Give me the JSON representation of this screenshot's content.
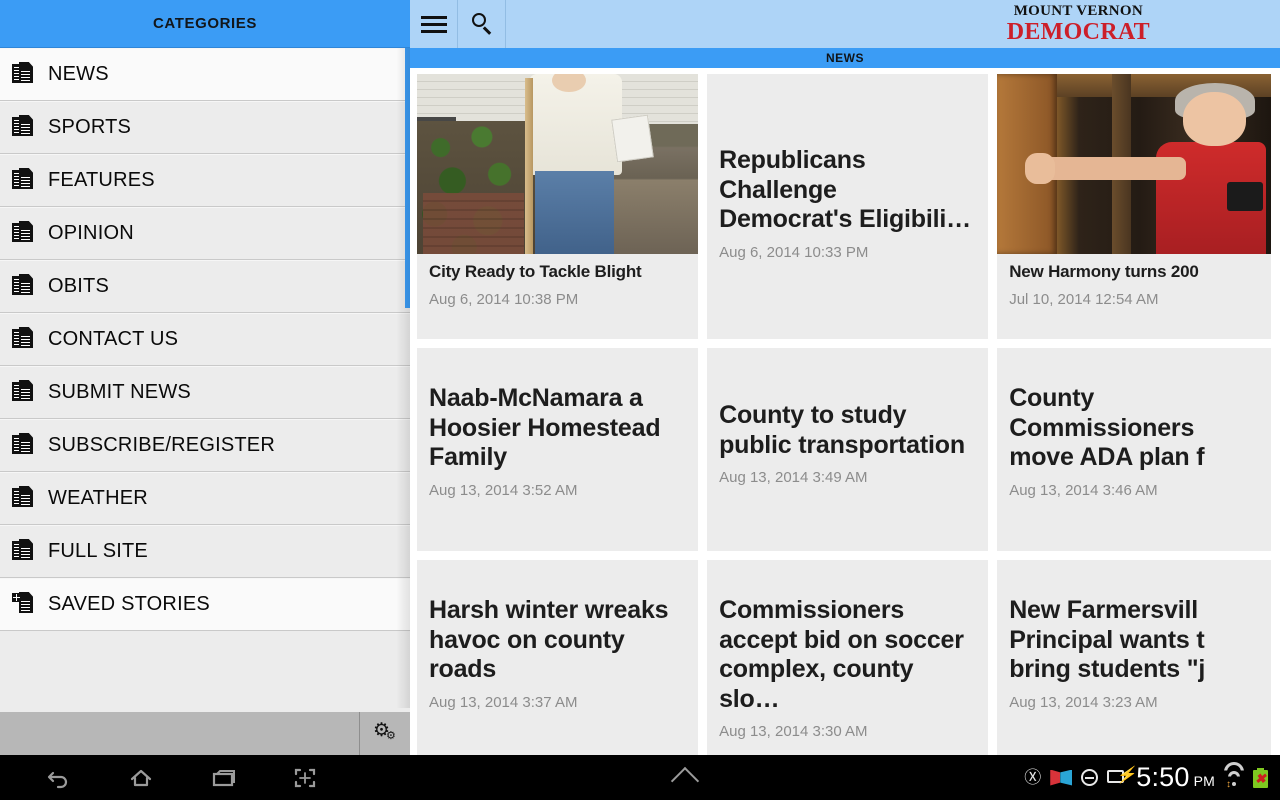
{
  "drawer": {
    "header_title": "CATEGORIES",
    "items": [
      {
        "label": "NEWS",
        "icon": "documents-icon",
        "selected": true
      },
      {
        "label": "SPORTS",
        "icon": "documents-icon",
        "selected": false
      },
      {
        "label": "FEATURES",
        "icon": "documents-icon",
        "selected": false
      },
      {
        "label": "OPINION",
        "icon": "documents-icon",
        "selected": false
      },
      {
        "label": "OBITS",
        "icon": "documents-icon",
        "selected": false
      },
      {
        "label": "CONTACT US",
        "icon": "documents-icon",
        "selected": false
      },
      {
        "label": "SUBMIT NEWS",
        "icon": "documents-icon",
        "selected": false
      },
      {
        "label": "SUBSCRIBE/REGISTER",
        "icon": "documents-icon",
        "selected": false
      },
      {
        "label": "WEATHER",
        "icon": "documents-icon",
        "selected": false
      },
      {
        "label": "FULL SITE",
        "icon": "documents-icon",
        "selected": false
      },
      {
        "label": "SAVED STORIES",
        "icon": "add-document-icon",
        "selected": false
      }
    ],
    "footer": {
      "settings_icon": "gear-icon"
    }
  },
  "app_bar": {
    "menu_icon": "hamburger-menu-icon",
    "search_icon": "search-icon",
    "masthead_line1": "MOUNT VERNON",
    "masthead_line2": "DEMOCRAT",
    "masthead_color": "#cc1f2a",
    "accent_color": "#3b9cf5",
    "bar_color": "#aed4f7"
  },
  "section_bar": {
    "label": "NEWS"
  },
  "articles": [
    {
      "title": "City Ready to Tackle Blight",
      "date": "Aug 6, 2014 10:38 PM",
      "has_image": true,
      "image": "woman-with-shovel-photo"
    },
    {
      "title": "Republicans Challenge Democrat's Eligibili…",
      "date": "Aug 6, 2014 10:33 PM",
      "has_image": false,
      "image": ""
    },
    {
      "title": "New Harmony turns 200",
      "date": "Jul 10, 2014 12:54 AM",
      "has_image": true,
      "image": "woman-in-red-shirt-photo"
    },
    {
      "title": "Naab-McNamara a Hoosier Homestead Family",
      "date": "Aug 13, 2014 3:52 AM",
      "has_image": false,
      "image": ""
    },
    {
      "title": "County to study public transportation",
      "date": "Aug 13, 2014 3:49 AM",
      "has_image": false,
      "image": ""
    },
    {
      "title": "County Commissioners move ADA plan f",
      "date": "Aug 13, 2014 3:46 AM",
      "has_image": false,
      "image": ""
    },
    {
      "title": "Harsh winter wreaks havoc on county roads",
      "date": "Aug 13, 2014 3:37 AM",
      "has_image": false,
      "image": ""
    },
    {
      "title": "Commissioners accept bid on soccer complex, county slo…",
      "date": "Aug 13, 2014 3:30 AM",
      "has_image": false,
      "image": ""
    },
    {
      "title": "New Farmersvill Principal wants t bring students \"j",
      "date": "Aug 13, 2014 3:23 AM",
      "has_image": false,
      "image": ""
    }
  ],
  "navbar": {
    "back_icon": "back-arrow-icon",
    "home_icon": "home-icon",
    "recents_icon": "recent-apps-icon",
    "screenshot_icon": "screenshot-icon",
    "expand_icon": "chevron-up-icon",
    "status_icons": [
      "usb-icon",
      "app-flag-icon",
      "do-not-disturb-icon",
      "usb-charging-icon",
      "wifi-icon",
      "battery-icon"
    ],
    "clock_time": "5:50",
    "clock_ampm": "PM"
  }
}
